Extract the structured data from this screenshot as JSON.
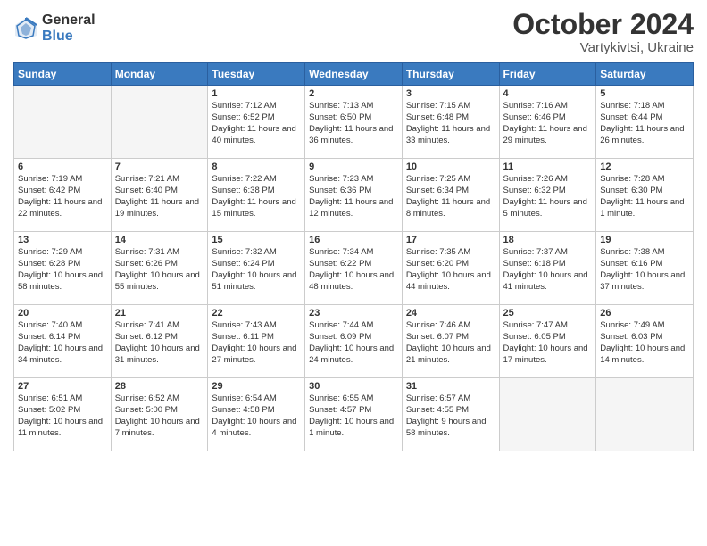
{
  "logo": {
    "general": "General",
    "blue": "Blue"
  },
  "title": "October 2024",
  "location": "Vartykivtsi, Ukraine",
  "days_of_week": [
    "Sunday",
    "Monday",
    "Tuesday",
    "Wednesday",
    "Thursday",
    "Friday",
    "Saturday"
  ],
  "weeks": [
    [
      {
        "day": "",
        "empty": true
      },
      {
        "day": "",
        "empty": true
      },
      {
        "day": "1",
        "sunrise": "Sunrise: 7:12 AM",
        "sunset": "Sunset: 6:52 PM",
        "daylight": "Daylight: 11 hours and 40 minutes."
      },
      {
        "day": "2",
        "sunrise": "Sunrise: 7:13 AM",
        "sunset": "Sunset: 6:50 PM",
        "daylight": "Daylight: 11 hours and 36 minutes."
      },
      {
        "day": "3",
        "sunrise": "Sunrise: 7:15 AM",
        "sunset": "Sunset: 6:48 PM",
        "daylight": "Daylight: 11 hours and 33 minutes."
      },
      {
        "day": "4",
        "sunrise": "Sunrise: 7:16 AM",
        "sunset": "Sunset: 6:46 PM",
        "daylight": "Daylight: 11 hours and 29 minutes."
      },
      {
        "day": "5",
        "sunrise": "Sunrise: 7:18 AM",
        "sunset": "Sunset: 6:44 PM",
        "daylight": "Daylight: 11 hours and 26 minutes."
      }
    ],
    [
      {
        "day": "6",
        "sunrise": "Sunrise: 7:19 AM",
        "sunset": "Sunset: 6:42 PM",
        "daylight": "Daylight: 11 hours and 22 minutes."
      },
      {
        "day": "7",
        "sunrise": "Sunrise: 7:21 AM",
        "sunset": "Sunset: 6:40 PM",
        "daylight": "Daylight: 11 hours and 19 minutes."
      },
      {
        "day": "8",
        "sunrise": "Sunrise: 7:22 AM",
        "sunset": "Sunset: 6:38 PM",
        "daylight": "Daylight: 11 hours and 15 minutes."
      },
      {
        "day": "9",
        "sunrise": "Sunrise: 7:23 AM",
        "sunset": "Sunset: 6:36 PM",
        "daylight": "Daylight: 11 hours and 12 minutes."
      },
      {
        "day": "10",
        "sunrise": "Sunrise: 7:25 AM",
        "sunset": "Sunset: 6:34 PM",
        "daylight": "Daylight: 11 hours and 8 minutes."
      },
      {
        "day": "11",
        "sunrise": "Sunrise: 7:26 AM",
        "sunset": "Sunset: 6:32 PM",
        "daylight": "Daylight: 11 hours and 5 minutes."
      },
      {
        "day": "12",
        "sunrise": "Sunrise: 7:28 AM",
        "sunset": "Sunset: 6:30 PM",
        "daylight": "Daylight: 11 hours and 1 minute."
      }
    ],
    [
      {
        "day": "13",
        "sunrise": "Sunrise: 7:29 AM",
        "sunset": "Sunset: 6:28 PM",
        "daylight": "Daylight: 10 hours and 58 minutes."
      },
      {
        "day": "14",
        "sunrise": "Sunrise: 7:31 AM",
        "sunset": "Sunset: 6:26 PM",
        "daylight": "Daylight: 10 hours and 55 minutes."
      },
      {
        "day": "15",
        "sunrise": "Sunrise: 7:32 AM",
        "sunset": "Sunset: 6:24 PM",
        "daylight": "Daylight: 10 hours and 51 minutes."
      },
      {
        "day": "16",
        "sunrise": "Sunrise: 7:34 AM",
        "sunset": "Sunset: 6:22 PM",
        "daylight": "Daylight: 10 hours and 48 minutes."
      },
      {
        "day": "17",
        "sunrise": "Sunrise: 7:35 AM",
        "sunset": "Sunset: 6:20 PM",
        "daylight": "Daylight: 10 hours and 44 minutes."
      },
      {
        "day": "18",
        "sunrise": "Sunrise: 7:37 AM",
        "sunset": "Sunset: 6:18 PM",
        "daylight": "Daylight: 10 hours and 41 minutes."
      },
      {
        "day": "19",
        "sunrise": "Sunrise: 7:38 AM",
        "sunset": "Sunset: 6:16 PM",
        "daylight": "Daylight: 10 hours and 37 minutes."
      }
    ],
    [
      {
        "day": "20",
        "sunrise": "Sunrise: 7:40 AM",
        "sunset": "Sunset: 6:14 PM",
        "daylight": "Daylight: 10 hours and 34 minutes."
      },
      {
        "day": "21",
        "sunrise": "Sunrise: 7:41 AM",
        "sunset": "Sunset: 6:12 PM",
        "daylight": "Daylight: 10 hours and 31 minutes."
      },
      {
        "day": "22",
        "sunrise": "Sunrise: 7:43 AM",
        "sunset": "Sunset: 6:11 PM",
        "daylight": "Daylight: 10 hours and 27 minutes."
      },
      {
        "day": "23",
        "sunrise": "Sunrise: 7:44 AM",
        "sunset": "Sunset: 6:09 PM",
        "daylight": "Daylight: 10 hours and 24 minutes."
      },
      {
        "day": "24",
        "sunrise": "Sunrise: 7:46 AM",
        "sunset": "Sunset: 6:07 PM",
        "daylight": "Daylight: 10 hours and 21 minutes."
      },
      {
        "day": "25",
        "sunrise": "Sunrise: 7:47 AM",
        "sunset": "Sunset: 6:05 PM",
        "daylight": "Daylight: 10 hours and 17 minutes."
      },
      {
        "day": "26",
        "sunrise": "Sunrise: 7:49 AM",
        "sunset": "Sunset: 6:03 PM",
        "daylight": "Daylight: 10 hours and 14 minutes."
      }
    ],
    [
      {
        "day": "27",
        "sunrise": "Sunrise: 6:51 AM",
        "sunset": "Sunset: 5:02 PM",
        "daylight": "Daylight: 10 hours and 11 minutes."
      },
      {
        "day": "28",
        "sunrise": "Sunrise: 6:52 AM",
        "sunset": "Sunset: 5:00 PM",
        "daylight": "Daylight: 10 hours and 7 minutes."
      },
      {
        "day": "29",
        "sunrise": "Sunrise: 6:54 AM",
        "sunset": "Sunset: 4:58 PM",
        "daylight": "Daylight: 10 hours and 4 minutes."
      },
      {
        "day": "30",
        "sunrise": "Sunrise: 6:55 AM",
        "sunset": "Sunset: 4:57 PM",
        "daylight": "Daylight: 10 hours and 1 minute."
      },
      {
        "day": "31",
        "sunrise": "Sunrise: 6:57 AM",
        "sunset": "Sunset: 4:55 PM",
        "daylight": "Daylight: 9 hours and 58 minutes."
      },
      {
        "day": "",
        "empty": true
      },
      {
        "day": "",
        "empty": true
      }
    ]
  ]
}
